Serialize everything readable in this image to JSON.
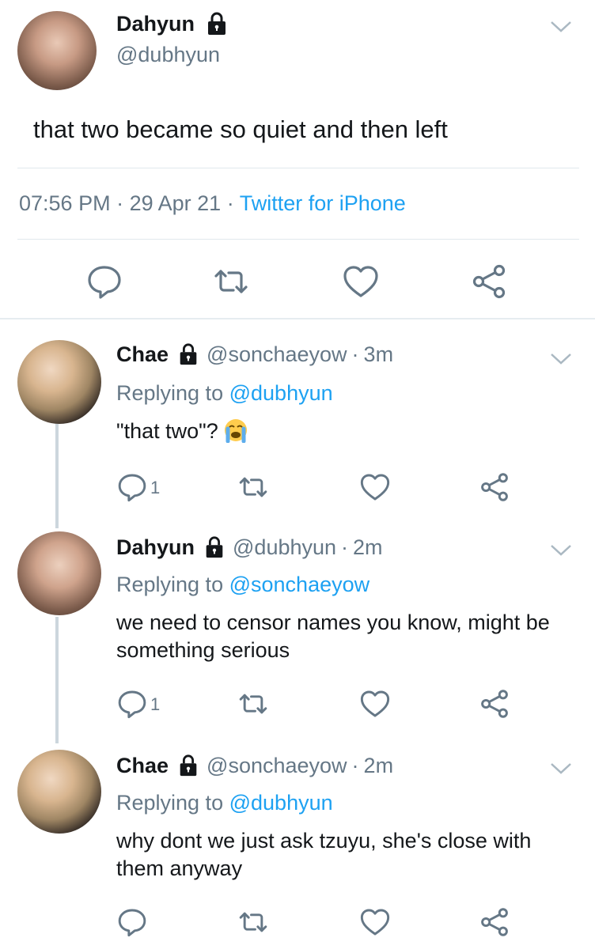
{
  "main": {
    "name": "Dahyun",
    "handle": "@dubhyun",
    "text": "that two became so quiet and then left",
    "time": "07:56 PM",
    "date": "29 Apr 21",
    "source": "Twitter for iPhone",
    "separator": "·"
  },
  "replies": [
    {
      "name": "Chae",
      "handle": "@sonchaeyow",
      "age": "3m",
      "replying_label": "Replying to",
      "replying_to": "@dubhyun",
      "text": "\"that two\"?",
      "emoji": "loudly-crying-face",
      "reply_count": "1"
    },
    {
      "name": "Dahyun",
      "handle": "@dubhyun",
      "age": "2m",
      "replying_label": "Replying to",
      "replying_to": "@sonchaeyow",
      "text": "we need to censor names you know, might be something serious",
      "reply_count": "1"
    },
    {
      "name": "Chae",
      "handle": "@sonchaeyow",
      "age": "2m",
      "replying_label": "Replying to",
      "replying_to": "@dubhyun",
      "text": "why dont we just ask tzuyu, she's close with them anyway",
      "reply_count": ""
    }
  ],
  "icons": [
    "lock-icon",
    "chevron-down-icon",
    "reply-icon",
    "retweet-icon",
    "like-icon",
    "share-icon"
  ],
  "colors": {
    "link": "#1da1f2",
    "muted": "#657786",
    "text": "#14171a",
    "divider": "#e1e8ed"
  }
}
